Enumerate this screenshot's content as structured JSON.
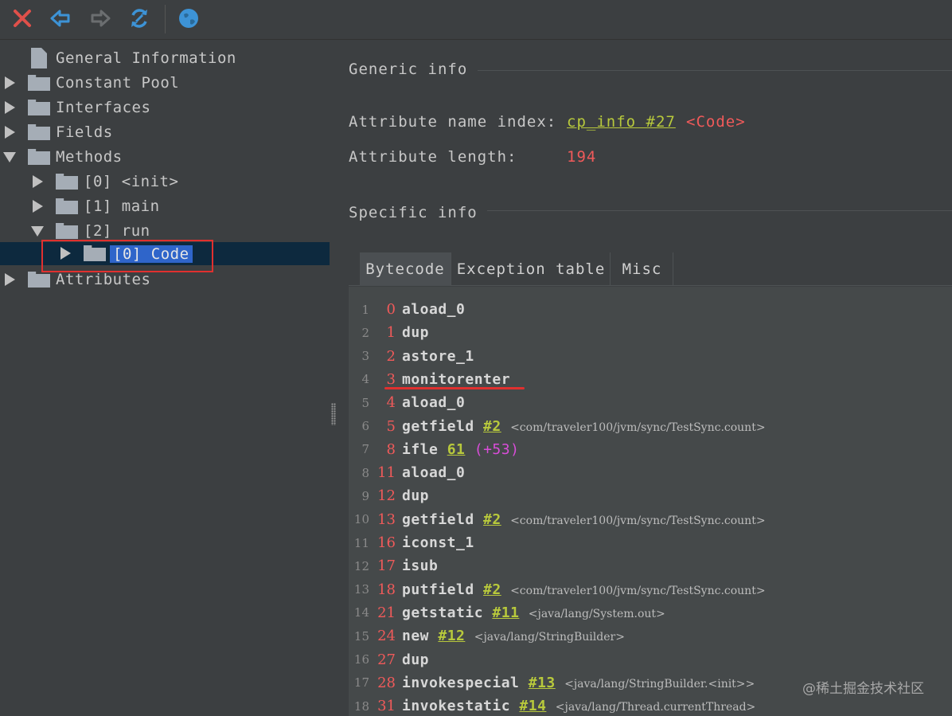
{
  "toolbar": {
    "buttons": [
      {
        "name": "close-icon",
        "color": "#e0504a"
      },
      {
        "name": "back-icon",
        "color": "#3d93d6"
      },
      {
        "name": "forward-icon",
        "color": "#6b6e70"
      },
      {
        "name": "refresh-icon",
        "color": "#3d93d6"
      },
      {
        "name": "web-icon",
        "color": "#3d93d6"
      }
    ]
  },
  "tree": {
    "items": [
      {
        "label": "General Information"
      },
      {
        "label": "Constant Pool"
      },
      {
        "label": "Interfaces"
      },
      {
        "label": "Fields"
      },
      {
        "label": "Methods"
      },
      {
        "label": "[0] <init>"
      },
      {
        "label": "[1] main"
      },
      {
        "label": "[2] run"
      },
      {
        "label": "[0] Code"
      },
      {
        "label": "Attributes"
      }
    ]
  },
  "generic": {
    "title": "Generic info",
    "name_index_label": "Attribute name index:",
    "name_index_link": "cp_info #27",
    "name_index_value": "<Code>",
    "length_label": "Attribute length:",
    "length_value": "194"
  },
  "specific": {
    "title": "Specific info",
    "tabs": [
      "Bytecode",
      "Exception table",
      "Misc"
    ]
  },
  "bytecode": [
    {
      "ln": "1",
      "off": "0",
      "op": "aload_0"
    },
    {
      "ln": "2",
      "off": "1",
      "op": "dup"
    },
    {
      "ln": "3",
      "off": "2",
      "op": "astore_1"
    },
    {
      "ln": "4",
      "off": "3",
      "op": "monitorenter"
    },
    {
      "ln": "5",
      "off": "4",
      "op": "aload_0"
    },
    {
      "ln": "6",
      "off": "5",
      "op": "getfield",
      "ref": "#2",
      "comment": "<com/traveler100/jvm/sync/TestSync.count>"
    },
    {
      "ln": "7",
      "off": "8",
      "op": "ifle",
      "ref": "61",
      "delta": "(+53)"
    },
    {
      "ln": "8",
      "off": "11",
      "op": "aload_0"
    },
    {
      "ln": "9",
      "off": "12",
      "op": "dup"
    },
    {
      "ln": "10",
      "off": "13",
      "op": "getfield",
      "ref": "#2",
      "comment": "<com/traveler100/jvm/sync/TestSync.count>"
    },
    {
      "ln": "11",
      "off": "16",
      "op": "iconst_1"
    },
    {
      "ln": "12",
      "off": "17",
      "op": "isub"
    },
    {
      "ln": "13",
      "off": "18",
      "op": "putfield",
      "ref": "#2",
      "comment": "<com/traveler100/jvm/sync/TestSync.count>"
    },
    {
      "ln": "14",
      "off": "21",
      "op": "getstatic",
      "ref": "#11",
      "comment": "<java/lang/System.out>"
    },
    {
      "ln": "15",
      "off": "24",
      "op": "new",
      "ref": "#12",
      "comment": "<java/lang/StringBuilder>"
    },
    {
      "ln": "16",
      "off": "27",
      "op": "dup"
    },
    {
      "ln": "17",
      "off": "28",
      "op": "invokespecial",
      "ref": "#13",
      "comment": "<java/lang/StringBuilder.<init>>"
    },
    {
      "ln": "18",
      "off": "31",
      "op": "invokestatic",
      "ref": "#14",
      "comment": "<java/lang/Thread.currentThread>"
    }
  ],
  "watermark": "@稀土掘金技术社区"
}
